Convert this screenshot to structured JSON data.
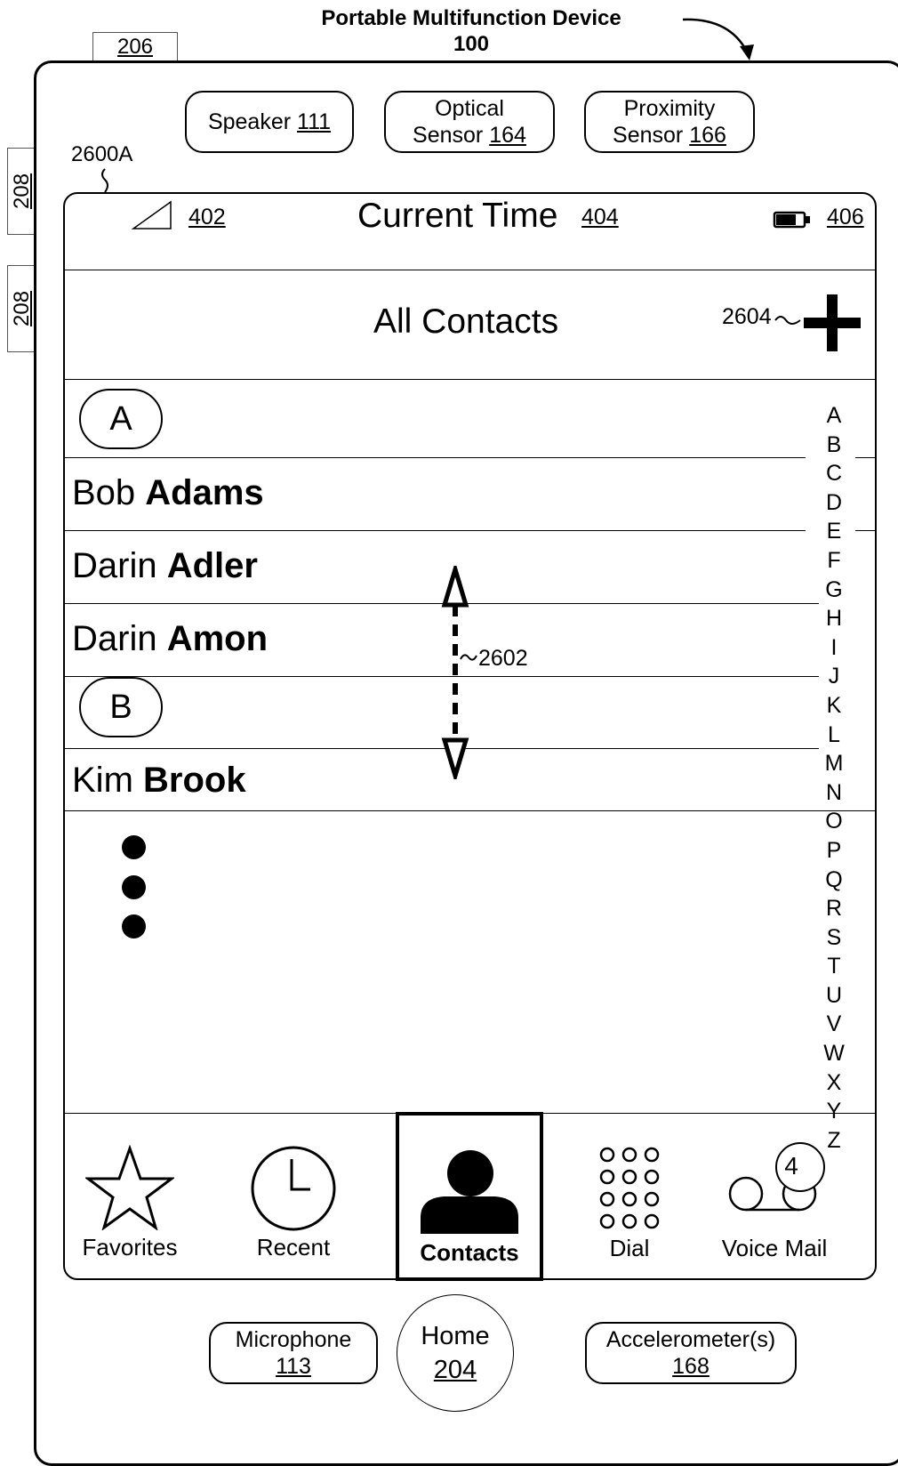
{
  "figure": {
    "title": "Portable Multifunction Device",
    "device_ref": "100",
    "ref_206": "206",
    "ref_208_top": "208",
    "ref_208_bottom": "208",
    "ref_2600A": "2600A"
  },
  "hardware_top": [
    {
      "name": "Speaker",
      "ref": "111"
    },
    {
      "name": "Optical",
      "name2": "Sensor",
      "ref": "164"
    },
    {
      "name": "Proximity",
      "name2": "Sensor",
      "ref": "166"
    }
  ],
  "status_bar": {
    "signal_ref": "402",
    "time_label": "Current Time",
    "time_ref": "404",
    "battery_ref": "406"
  },
  "header": {
    "title": "All Contacts",
    "add_ref": "2604"
  },
  "list": {
    "section_a": "A",
    "section_b": "B",
    "contacts": [
      {
        "first": "Bob",
        "last": "Adams"
      },
      {
        "first": "Darin",
        "last": "Adler"
      },
      {
        "first": "Darin",
        "last": "Amon"
      },
      {
        "first": "Kim",
        "last": "Brook"
      }
    ],
    "scroll_ref": "2602"
  },
  "index_letters": [
    "A",
    "B",
    "C",
    "D",
    "E",
    "F",
    "G",
    "H",
    "I",
    "J",
    "K",
    "L",
    "M",
    "N",
    "O",
    "P",
    "Q",
    "R",
    "S",
    "T",
    "U",
    "V",
    "W",
    "X",
    "Y",
    "Z"
  ],
  "tabs": {
    "favorites": "Favorites",
    "recent": "Recent",
    "contacts": "Contacts",
    "dial": "Dial",
    "voicemail": "Voice Mail",
    "voicemail_badge": "4",
    "active": "contacts"
  },
  "hardware_bottom": {
    "microphone": "Microphone",
    "microphone_ref": "113",
    "home": "Home",
    "home_ref": "204",
    "accelerometer": "Accelerometer(s)",
    "accelerometer_ref": "168"
  },
  "icons": {
    "signal": "signal-icon",
    "battery": "battery-icon",
    "add": "plus-icon",
    "favorites": "star-icon",
    "recent": "clock-icon",
    "contacts": "person-icon",
    "dial": "keypad-icon",
    "voicemail": "voicemail-icon"
  }
}
